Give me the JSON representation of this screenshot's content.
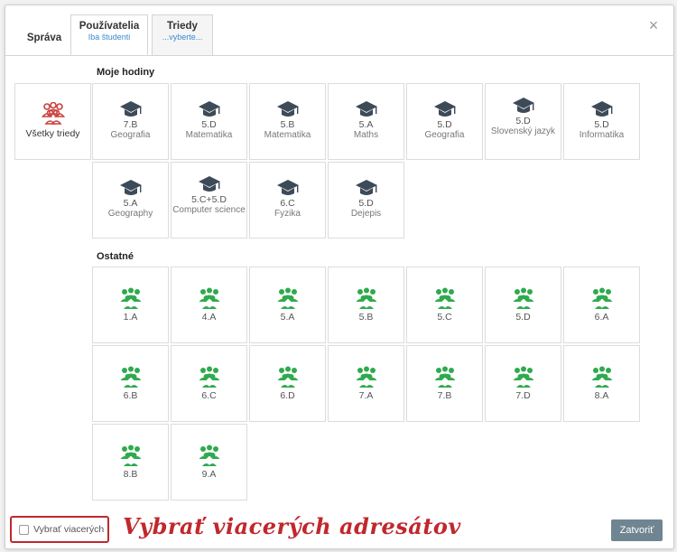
{
  "tabs": [
    {
      "label": "Správa",
      "sub": ""
    },
    {
      "label": "Používatelia",
      "sub": "Iba študenti"
    },
    {
      "label": "Triedy",
      "sub": "...vyberte..."
    }
  ],
  "close_icon": "×",
  "sections": {
    "my_lessons_label": "Moje hodiny",
    "other_label": "Ostatné"
  },
  "all_classes": {
    "label": "Všetky triedy",
    "icon": "group-icon",
    "color": "#c9413e"
  },
  "my_lessons": [
    {
      "cls": "7.B",
      "subject": "Geografia"
    },
    {
      "cls": "5.D",
      "subject": "Matematika"
    },
    {
      "cls": "5.B",
      "subject": "Matematika"
    },
    {
      "cls": "5.A",
      "subject": "Maths"
    },
    {
      "cls": "5.D",
      "subject": "Geografia"
    },
    {
      "cls": "5.D",
      "subject": "Slovenský jazyk"
    },
    {
      "cls": "5.D",
      "subject": "Informatika"
    },
    {
      "cls": "5.A",
      "subject": "Geography"
    },
    {
      "cls": "5.C+5.D",
      "subject": "Computer science"
    },
    {
      "cls": "6.C",
      "subject": "Fyzika"
    },
    {
      "cls": "5.D",
      "subject": "Dejepis"
    }
  ],
  "other_classes": [
    "1.A",
    "4.A",
    "5.A",
    "5.B",
    "5.C",
    "5.D",
    "6.A",
    "6.B",
    "6.C",
    "6.D",
    "7.A",
    "7.B",
    "7.D",
    "8.A",
    "8.B",
    "9.A"
  ],
  "colors": {
    "cap": "#3d4a58",
    "group": "#2faa4e",
    "accent": "#c0282d",
    "link": "#3a8ad1"
  },
  "footer": {
    "select_multiple_label": "Vybrať viacerých",
    "annotation": "Vybrať viacerých adresátov",
    "close_button": "Zatvoriť"
  }
}
